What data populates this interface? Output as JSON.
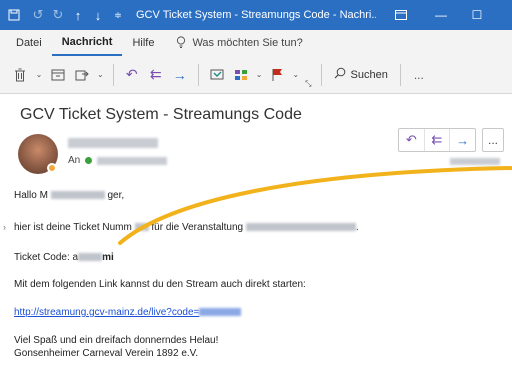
{
  "titlebar": {
    "title": "GCV Ticket System - Streamungs Code - Nachri...",
    "icons": [
      "save-icon",
      "undo-icon",
      "redo-icon",
      "up-arrow-icon",
      "down-arrow-icon",
      "customize-icon"
    ],
    "controls": [
      "window-mode-icon",
      "minimize-icon",
      "maximize-icon",
      "close-icon"
    ]
  },
  "menu": {
    "items": [
      {
        "label": "Datei",
        "active": false
      },
      {
        "label": "Nachricht",
        "active": true
      },
      {
        "label": "Hilfe",
        "active": false
      }
    ],
    "tellme": "Was möchten Sie tun?"
  },
  "ribbon": {
    "search_label": "Suchen",
    "more_label": "..."
  },
  "message": {
    "subject": "GCV Ticket System - Streamungs Code",
    "to_label": "An",
    "greeting_prefix": "Hallo M",
    "greeting_suffix": "ger,",
    "line1_prefix": "hier ist deine Ticket Numm",
    "line1_middle": "für die Veranstaltung",
    "line1_suffix": ".",
    "ticket_label": "Ticket Code: a",
    "ticket_suffix": "mi",
    "stream_text": "Mit dem folgenden Link kannst du den Stream auch direkt starten:",
    "link_text": "http://streamung.gcv-mainz.de/live?code=",
    "closing1": "Viel Spaß und ein dreifach donnerndes Helau!",
    "closing2": "Gonsenheimer Carneval Verein 1892 e.V."
  },
  "colors": {
    "titlebar": "#2b6fc3",
    "link": "#1b4fd6",
    "annotation": "#f2b21b"
  }
}
